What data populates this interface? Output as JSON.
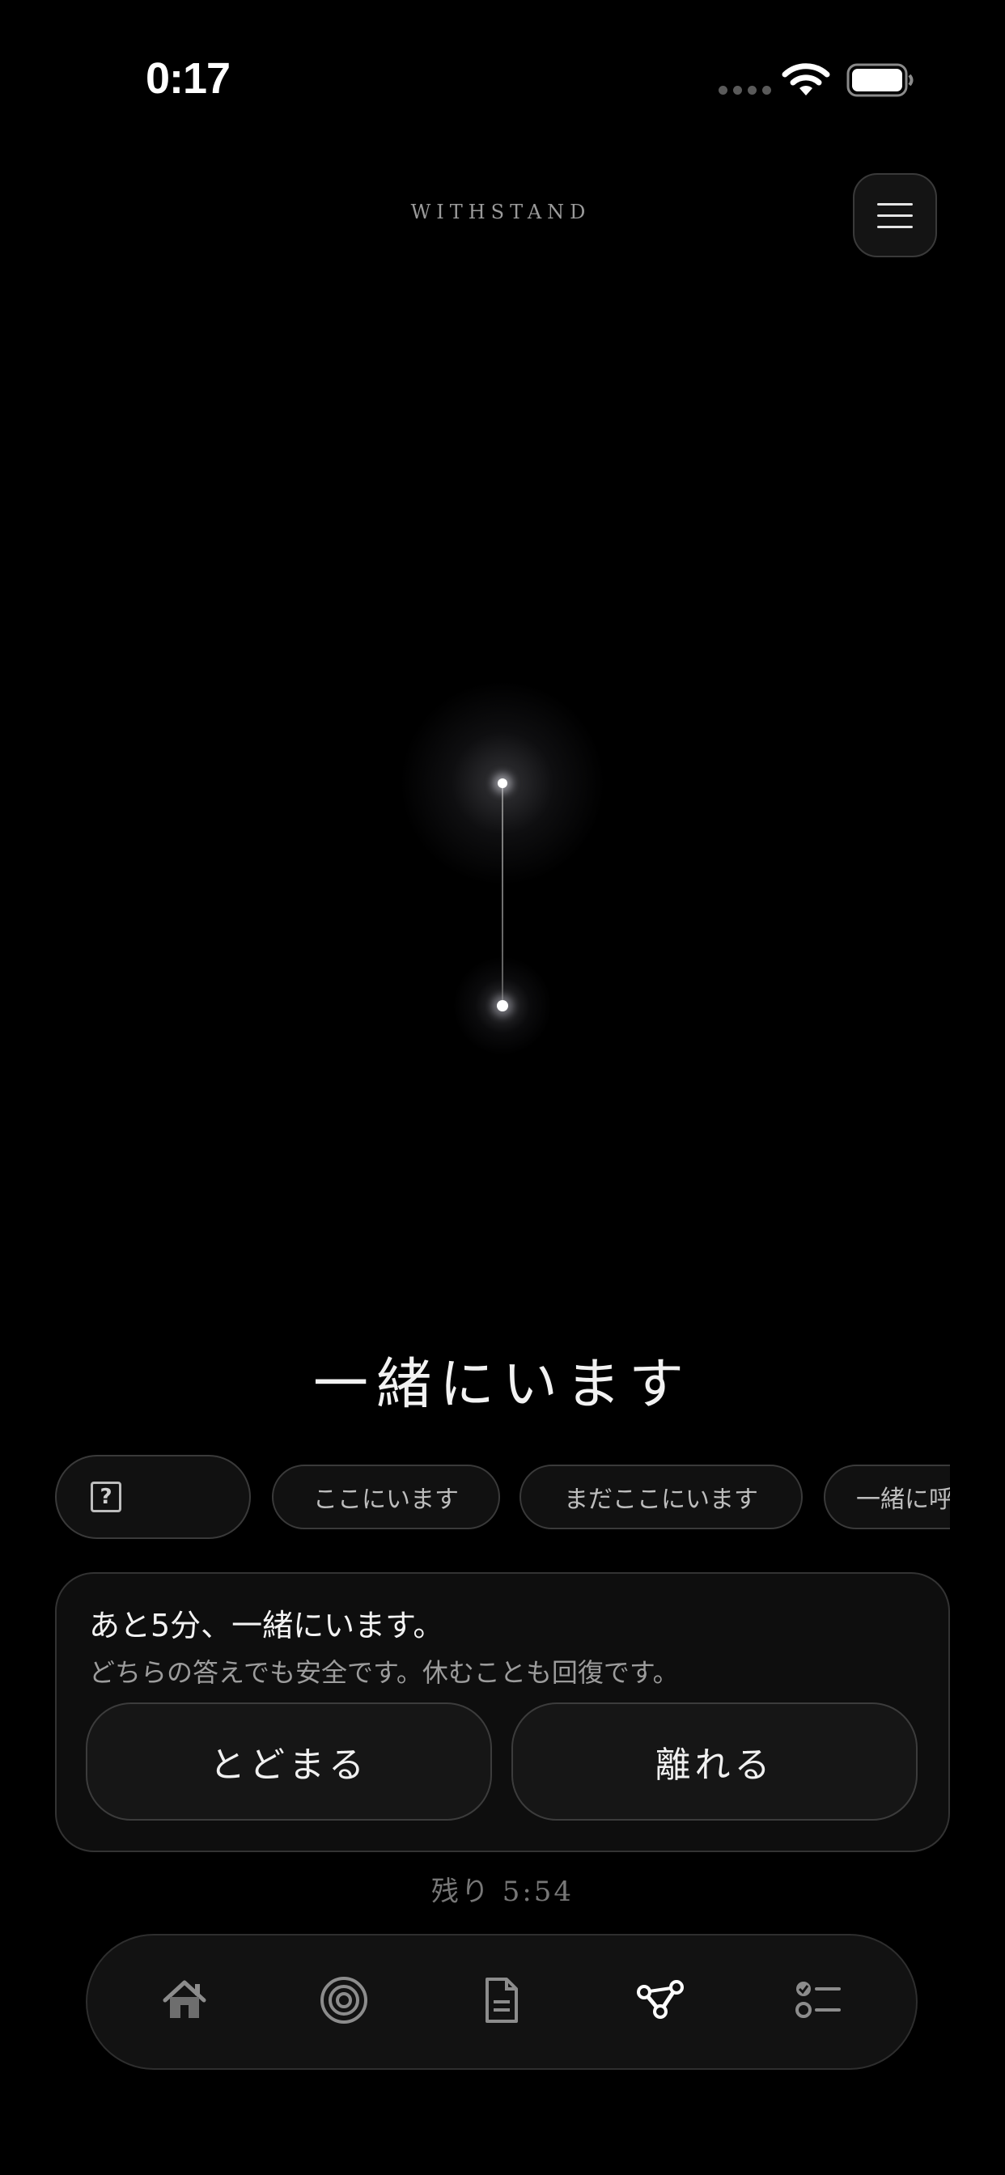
{
  "status_bar": {
    "time": "0:17"
  },
  "header": {
    "brand": "WITHSTAND",
    "menu_icon": "hamburger-menu-icon"
  },
  "main": {
    "title": "一緒にいます"
  },
  "chips": {
    "help_icon": "question-box-icon",
    "help_glyph": "?",
    "items": [
      "ここにいます",
      "まだここにいます",
      "一緒に呼"
    ]
  },
  "card": {
    "title": "あと5分、一緒にいます。",
    "subtitle": "どちらの答えでも安全です。休むことも回復です。",
    "stay_label": "とどまる",
    "leave_label": "離れる"
  },
  "remaining": "残り 5:54",
  "tabbar": {
    "items": [
      {
        "icon": "home-icon",
        "active": false
      },
      {
        "icon": "target-icon",
        "active": false
      },
      {
        "icon": "document-icon",
        "active": false
      },
      {
        "icon": "connections-icon",
        "active": true
      },
      {
        "icon": "checklist-icon",
        "active": false
      }
    ]
  },
  "colors": {
    "background": "#000000",
    "accent": "#ffffff",
    "muted": "#777777"
  }
}
